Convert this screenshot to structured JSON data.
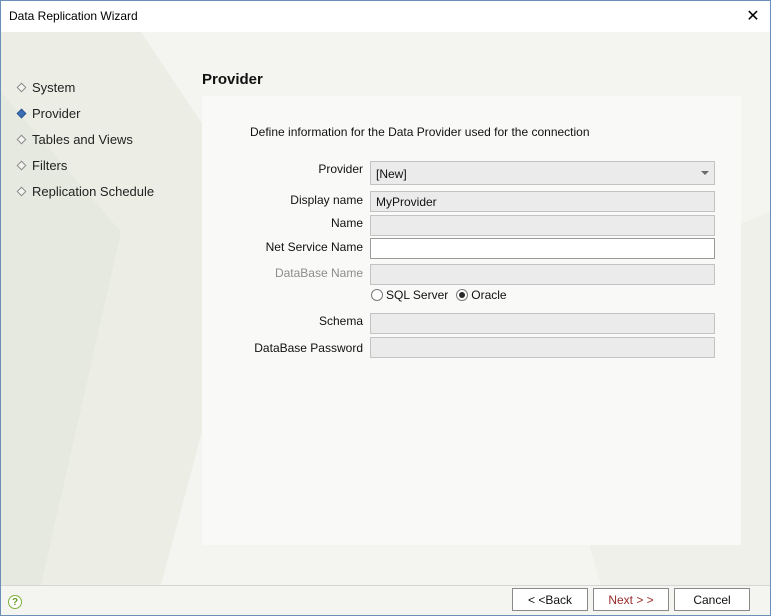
{
  "window": {
    "title": "Data Replication Wizard",
    "close_glyph": "✕"
  },
  "steps": [
    {
      "label": "System",
      "active": false
    },
    {
      "label": "Provider",
      "active": true
    },
    {
      "label": "Tables and Views",
      "active": false
    },
    {
      "label": "Filters",
      "active": false
    },
    {
      "label": "Replication Schedule",
      "active": false
    }
  ],
  "page": {
    "heading": "Provider",
    "intro": "Define information for the Data Provider used for the connection"
  },
  "form": {
    "provider": {
      "label": "Provider",
      "value": "[New]"
    },
    "display_name": {
      "label": "Display name",
      "value": "MyProvider"
    },
    "name": {
      "label": "Name",
      "value": ""
    },
    "net_service_name": {
      "label": "Net Service Name",
      "value": ""
    },
    "database_name": {
      "label": "DataBase Name",
      "value": ""
    },
    "db_type": {
      "options": [
        "SQL Server",
        "Oracle"
      ],
      "selected": "Oracle"
    },
    "schema": {
      "label": "Schema",
      "value": ""
    },
    "database_password": {
      "label": "DataBase Password",
      "value": ""
    }
  },
  "footer": {
    "help_glyph": "?",
    "back_label": "< <Back",
    "next_label": "Next > >",
    "cancel_label": "Cancel"
  },
  "colors": {
    "accent": "#3b6fb6",
    "next_text": "#9a2a2a",
    "help_green": "#6c9b2a"
  }
}
